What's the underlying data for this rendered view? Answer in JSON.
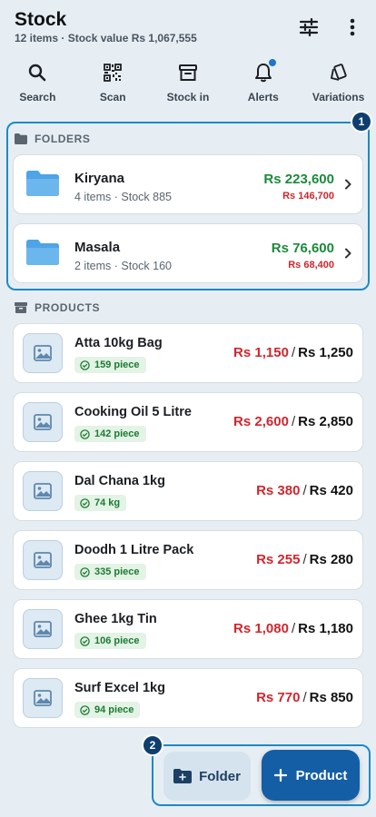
{
  "header": {
    "title": "Stock",
    "subtitle": "12 items · Stock value Rs 1,067,555",
    "filter_icon": "sliders-icon",
    "more_icon": "more-vertical-icon"
  },
  "quick_actions": [
    {
      "label": "Search",
      "icon": "search-icon"
    },
    {
      "label": "Scan",
      "icon": "qr-scan-icon"
    },
    {
      "label": "Stock in",
      "icon": "archive-icon"
    },
    {
      "label": "Alerts",
      "icon": "bell-icon"
    },
    {
      "label": "Variations",
      "icon": "cards-icon"
    }
  ],
  "folders_section": {
    "label": "FOLDERS",
    "badge": "1"
  },
  "folders": [
    {
      "name": "Kiryana",
      "meta": "4 items · Stock 885",
      "value": "Rs 223,600",
      "cost": "Rs 146,700"
    },
    {
      "name": "Masala",
      "meta": "2 items · Stock 160",
      "value": "Rs 76,600",
      "cost": "Rs 68,400"
    }
  ],
  "products_section": {
    "label": "PRODUCTS"
  },
  "products": [
    {
      "name": "Atta 10kg Bag",
      "stock": "159 piece",
      "buy": "Rs 1,150",
      "sep": "/",
      "sell": "Rs 1,250"
    },
    {
      "name": "Cooking Oil 5 Litre",
      "stock": "142 piece",
      "buy": "Rs 2,600",
      "sep": "/",
      "sell": "Rs 2,850"
    },
    {
      "name": "Dal Chana 1kg",
      "stock": "74 kg",
      "buy": "Rs 380",
      "sep": "/",
      "sell": "Rs 420"
    },
    {
      "name": "Doodh 1 Litre Pack",
      "stock": "335 piece",
      "buy": "Rs 255",
      "sep": "/",
      "sell": "Rs 280"
    },
    {
      "name": "Ghee 1kg Tin",
      "stock": "106 piece",
      "buy": "Rs 1,080",
      "sep": "/",
      "sell": "Rs 1,180"
    },
    {
      "name": "Surf Excel 1kg",
      "stock": "94 piece",
      "buy": "Rs 770",
      "sep": "/",
      "sell": "Rs 850"
    }
  ],
  "fab": {
    "badge": "2",
    "folder_label": "Folder",
    "product_label": "Product"
  },
  "colors": {
    "accent": "#145ea5",
    "price_cost": "#d0262d",
    "price_value": "#1c8a3b",
    "stock_badge": "#1e7a34",
    "highlight": "#1d8ac7"
  }
}
